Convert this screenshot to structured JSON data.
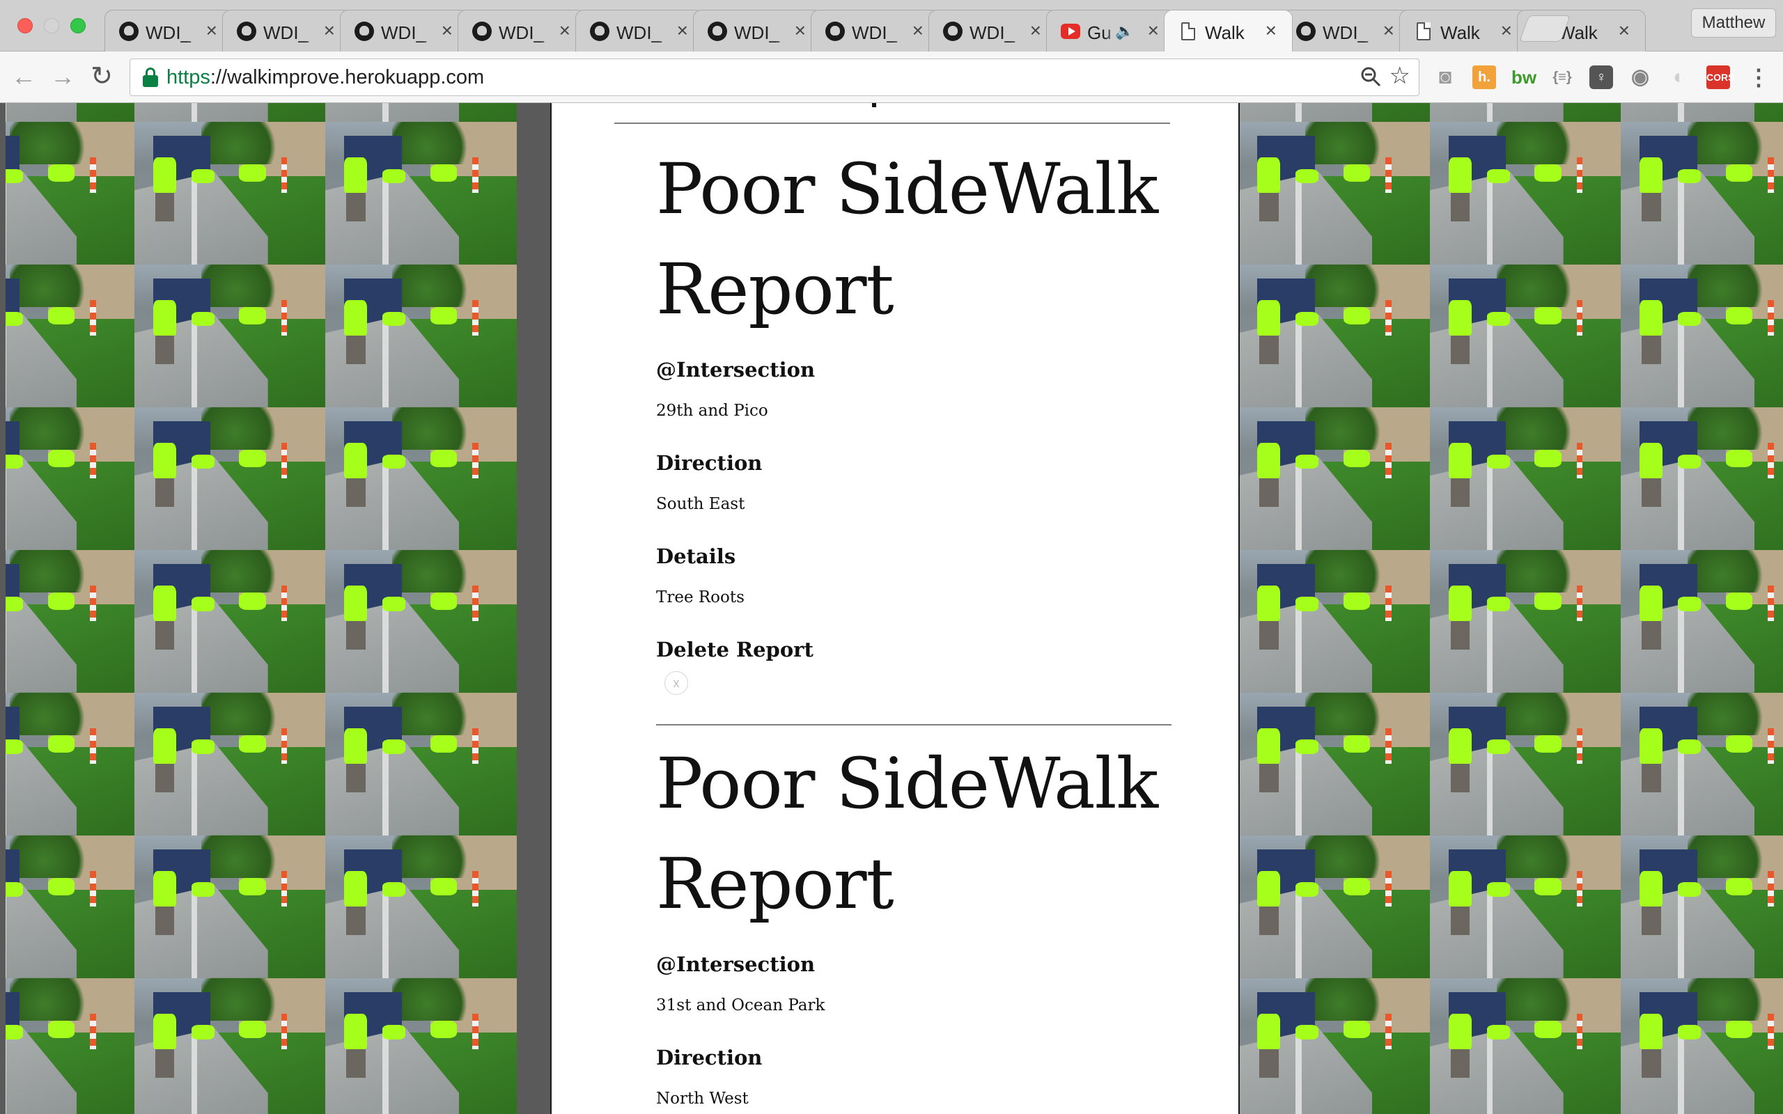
{
  "browser": {
    "tabs": [
      {
        "title": "WDI_",
        "favicon": "github-icon",
        "active": false
      },
      {
        "title": "WDI_",
        "favicon": "github-icon",
        "active": false
      },
      {
        "title": "WDI_",
        "favicon": "github-icon",
        "active": false
      },
      {
        "title": "WDI_",
        "favicon": "github-icon",
        "active": false
      },
      {
        "title": "WDI_",
        "favicon": "github-icon",
        "active": false
      },
      {
        "title": "WDI_",
        "favicon": "github-icon",
        "active": false
      },
      {
        "title": "WDI_",
        "favicon": "github-icon",
        "active": false
      },
      {
        "title": "WDI_",
        "favicon": "github-icon",
        "active": false
      },
      {
        "title": "Gu",
        "favicon": "youtube-icon",
        "active": false,
        "audio": true
      },
      {
        "title": "Walk",
        "favicon": "document-icon",
        "active": true
      },
      {
        "title": "WDI_",
        "favicon": "github-icon",
        "active": false
      },
      {
        "title": "Walk",
        "favicon": "document-icon",
        "active": false
      },
      {
        "title": "Walk",
        "favicon": "document-icon",
        "active": false
      }
    ],
    "close_glyph": "×",
    "profile_name": "Matthew",
    "url": {
      "scheme": "https",
      "rest": "://walkimprove.herokuapp.com"
    },
    "extensions": [
      {
        "name": "camera-icon",
        "glyph": "◙"
      },
      {
        "name": "hypothesis-icon",
        "glyph": "h."
      },
      {
        "name": "bw-icon",
        "glyph": "bw"
      },
      {
        "name": "json-viewer-icon",
        "glyph": "{≡}"
      },
      {
        "name": "lightbulb-icon",
        "glyph": "♀"
      },
      {
        "name": "record-icon",
        "glyph": "◉"
      },
      {
        "name": "moon-icon",
        "glyph": "◐"
      },
      {
        "name": "cors-icon",
        "glyph": "CORS"
      },
      {
        "name": "menu-icon",
        "glyph": "⋮"
      }
    ],
    "colors": {
      "secure_green": "#0b8043",
      "cors_red": "#d9332a"
    }
  },
  "page": {
    "reports": [
      {
        "title": "Poor SideWalk Report",
        "intersection_label": "@Intersection",
        "intersection": "29th and Pico",
        "direction_label": "Direction",
        "direction": "South East",
        "details_label": "Details",
        "details": "Tree Roots",
        "delete_label": "Delete Report",
        "delete_button": "x"
      },
      {
        "title": "Poor SideWalk Report",
        "intersection_label": "@Intersection",
        "intersection": "31st and Ocean Park",
        "direction_label": "Direction",
        "direction": "North West"
      }
    ]
  }
}
